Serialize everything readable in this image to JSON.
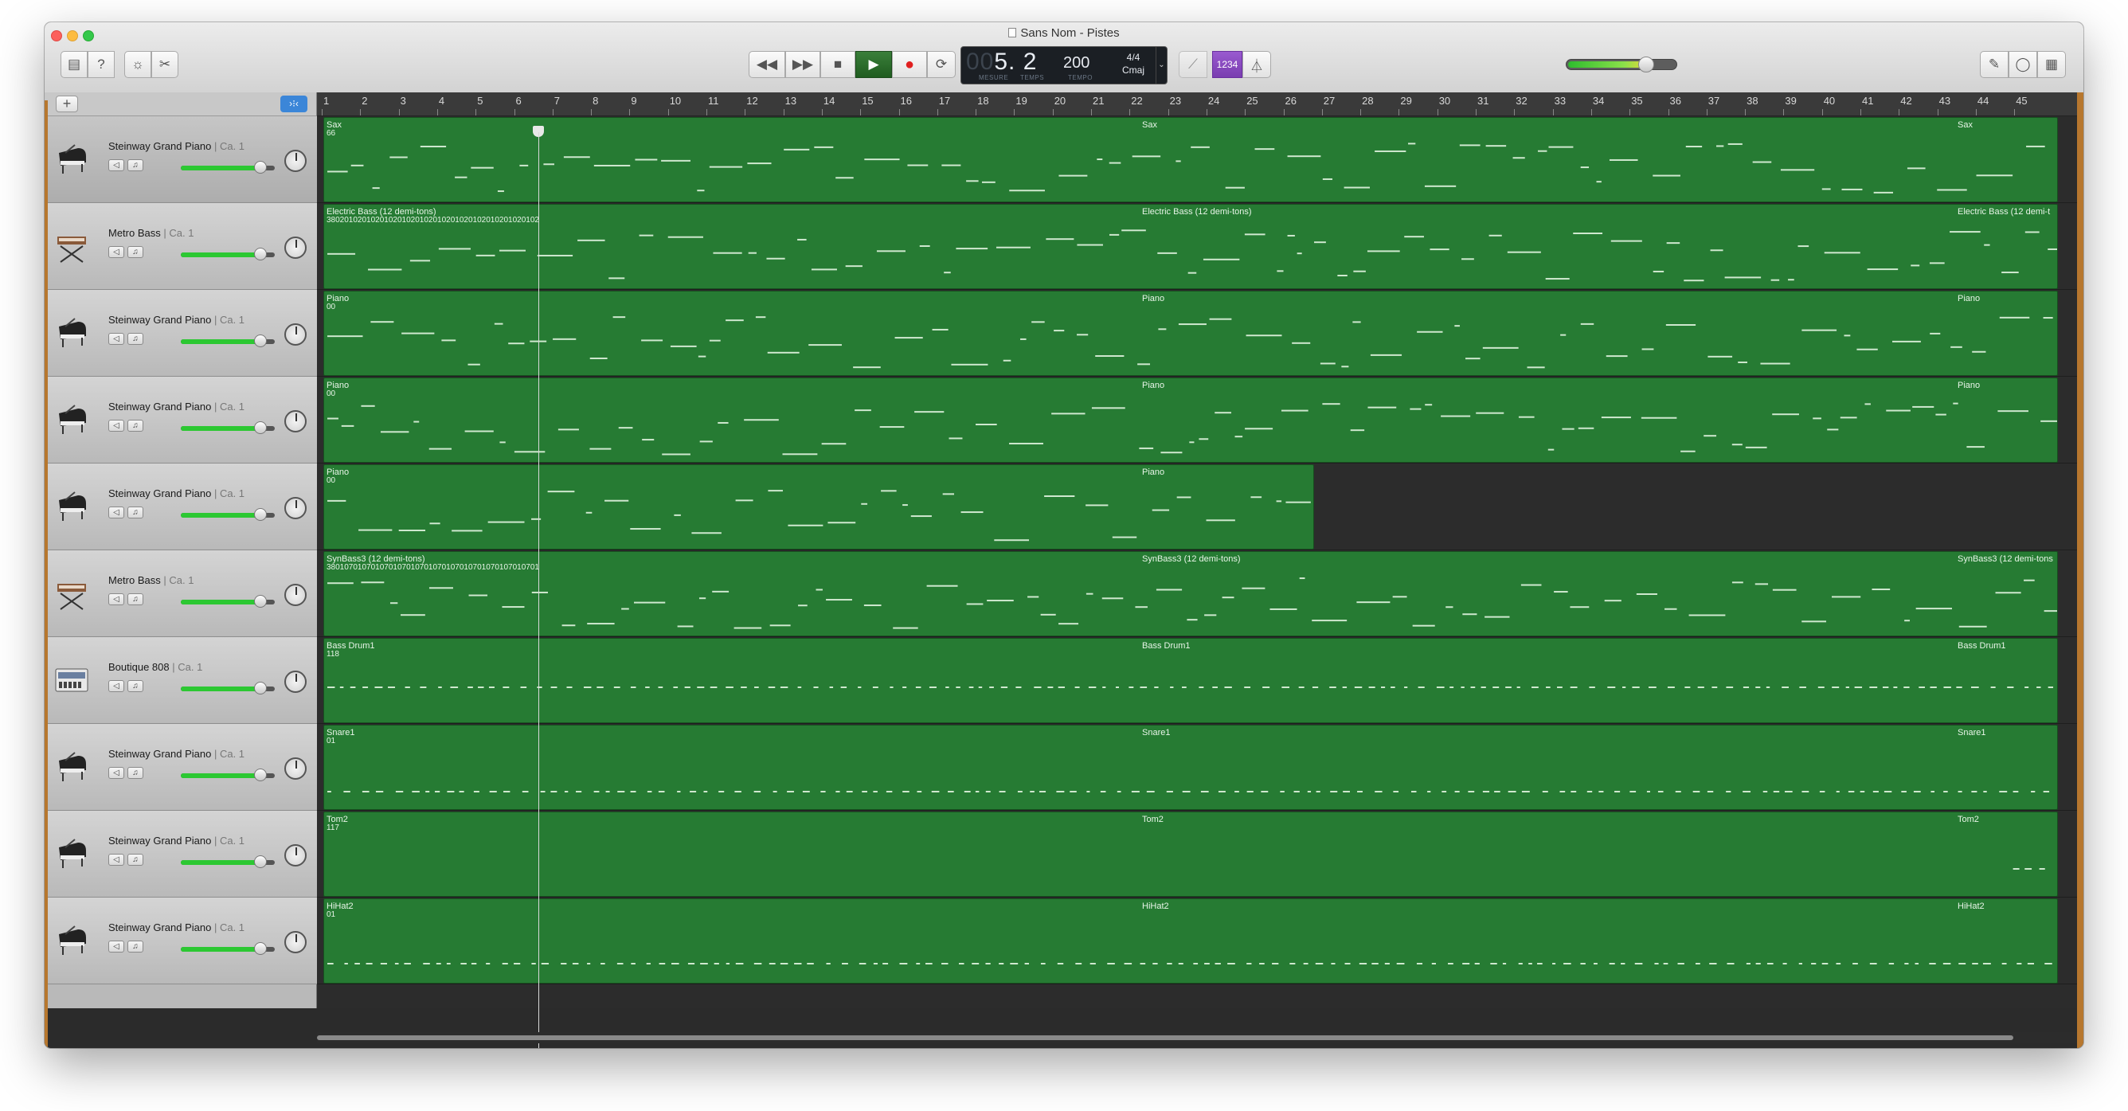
{
  "window": {
    "title": "Sans Nom - Pistes"
  },
  "lcd": {
    "bar": "5. 2",
    "bar_label": "MESURE",
    "beat_label": "TEMPS",
    "tempo": "200",
    "tempo_label": "TEMPO",
    "signature": "4/4",
    "key": "Cmaj"
  },
  "toolbar": {
    "count_in": "1234"
  },
  "ruler": [
    "1",
    "2",
    "3",
    "4",
    "5",
    "6",
    "7",
    "8",
    "9",
    "10",
    "11",
    "12",
    "13",
    "14",
    "15",
    "16",
    "17",
    "18",
    "19",
    "20",
    "21",
    "22",
    "23",
    "24",
    "25",
    "26",
    "27",
    "28",
    "29",
    "30",
    "31",
    "32",
    "33",
    "34",
    "35",
    "36",
    "37",
    "38",
    "39",
    "40",
    "41",
    "42",
    "43",
    "44",
    "45"
  ],
  "tracks": [
    {
      "name": "Steinway Grand Piano",
      "channel": "Ca. 1",
      "icon": "grand-piano-icon",
      "volume": 0.85,
      "regions": [
        {
          "name": "Sax",
          "num": "66"
        },
        {
          "name": "Sax"
        },
        {
          "name": "Sax"
        }
      ]
    },
    {
      "name": "Metro Bass",
      "channel": "Ca. 1",
      "icon": "synth-keyboard-icon",
      "volume": 0.85,
      "regions": [
        {
          "name": "Electric Bass (12 demi-tons)",
          "num": "380201020102010201020102010201020102010201020102"
        },
        {
          "name": "Electric Bass (12 demi-tons)"
        },
        {
          "name": "Electric Bass (12 demi-t"
        }
      ]
    },
    {
      "name": "Steinway Grand Piano",
      "channel": "Ca. 1",
      "icon": "grand-piano-icon",
      "volume": 0.85,
      "regions": [
        {
          "name": "Piano",
          "num": "00"
        },
        {
          "name": "Piano"
        },
        {
          "name": "Piano"
        }
      ]
    },
    {
      "name": "Steinway Grand Piano",
      "channel": "Ca. 1",
      "icon": "grand-piano-icon",
      "volume": 0.85,
      "regions": [
        {
          "name": "Piano",
          "num": "00"
        },
        {
          "name": "Piano"
        },
        {
          "name": "Piano"
        }
      ]
    },
    {
      "name": "Steinway Grand Piano",
      "channel": "Ca. 1",
      "icon": "grand-piano-icon",
      "volume": 0.85,
      "regions": [
        {
          "name": "Piano",
          "num": "00"
        },
        {
          "name": "Piano"
        }
      ]
    },
    {
      "name": "Metro Bass",
      "channel": "Ca. 1",
      "icon": "synth-keyboard-icon",
      "volume": 0.85,
      "regions": [
        {
          "name": "SynBass3 (12 demi-tons)",
          "num": "380107010701070107010701070107010701070107010701"
        },
        {
          "name": "SynBass3 (12 demi-tons)"
        },
        {
          "name": "SynBass3 (12 demi-tons"
        }
      ]
    },
    {
      "name": "Boutique 808",
      "channel": "Ca. 1",
      "icon": "drum-machine-icon",
      "volume": 0.85,
      "regions": [
        {
          "name": "Bass Drum1",
          "num": "118"
        },
        {
          "name": "Bass Drum1"
        },
        {
          "name": "Bass Drum1"
        }
      ]
    },
    {
      "name": "Steinway Grand Piano",
      "channel": "Ca. 1",
      "icon": "grand-piano-icon",
      "volume": 0.85,
      "regions": [
        {
          "name": "Snare1",
          "num": "01"
        },
        {
          "name": "Snare1"
        },
        {
          "name": "Snare1"
        }
      ]
    },
    {
      "name": "Steinway Grand Piano",
      "channel": "Ca. 1",
      "icon": "grand-piano-icon",
      "volume": 0.85,
      "regions": [
        {
          "name": "Tom2",
          "num": "117"
        },
        {
          "name": "Tom2"
        },
        {
          "name": "Tom2"
        }
      ]
    },
    {
      "name": "Steinway Grand Piano",
      "channel": "Ca. 1",
      "icon": "grand-piano-icon",
      "volume": 0.85,
      "regions": [
        {
          "name": "HiHat2",
          "num": "01"
        },
        {
          "name": "HiHat2"
        },
        {
          "name": "HiHat2"
        }
      ]
    }
  ]
}
